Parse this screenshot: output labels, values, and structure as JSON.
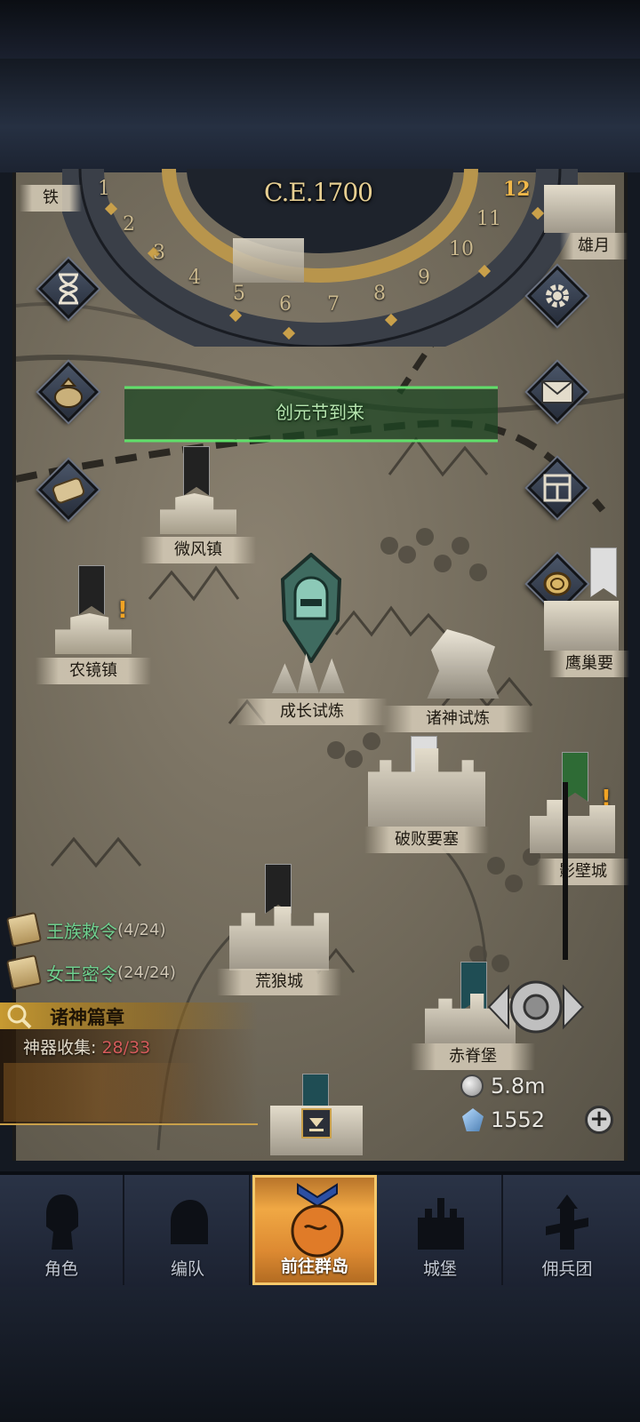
{
  "calendar": {
    "era": "C.E.1700",
    "months": [
      "1",
      "2",
      "3",
      "4",
      "5",
      "6",
      "7",
      "8",
      "9",
      "10",
      "11",
      "12"
    ],
    "current_month": "12"
  },
  "event_banner": {
    "text": "创元节到来"
  },
  "side_buttons_left": [
    {
      "icon": "hourglass-icon"
    },
    {
      "icon": "money-bag-icon"
    },
    {
      "icon": "scroll-icon"
    }
  ],
  "side_buttons_right": [
    {
      "icon": "gear-icon"
    },
    {
      "icon": "mail-icon"
    },
    {
      "icon": "window-grid-icon"
    },
    {
      "icon": "coin-icon"
    }
  ],
  "locations": {
    "weifeng": "微风镇",
    "nongjing": "农镜镇",
    "chengzhang": "成长试炼",
    "zhushen": "诸神试炼",
    "pobai": "破败要塞",
    "huanglang": "荒狼城",
    "chiji": "赤脊堡",
    "yingchao": "鹰巢要",
    "yuebi": "影壁城",
    "xiongyue": "雄月",
    "tie": "铁"
  },
  "quests": [
    {
      "name": "王族敕令",
      "count": "(4/24)"
    },
    {
      "name": "女王密令",
      "count": "(24/24)"
    }
  ],
  "gods_chapter": {
    "title": "诸神篇章",
    "collect_label": "神器收集:",
    "collect_value": "28/33"
  },
  "resources": {
    "silver": "5.8m",
    "crystal": "1552"
  },
  "nav": [
    {
      "label": "角色"
    },
    {
      "label": "编队"
    },
    {
      "label": "前往群岛"
    },
    {
      "label": "城堡"
    },
    {
      "label": "佣兵团"
    }
  ],
  "colors": {
    "quest_green": "#6fcf8e",
    "nav_active": "#f0a844",
    "collect_red": "#d45b5b"
  }
}
